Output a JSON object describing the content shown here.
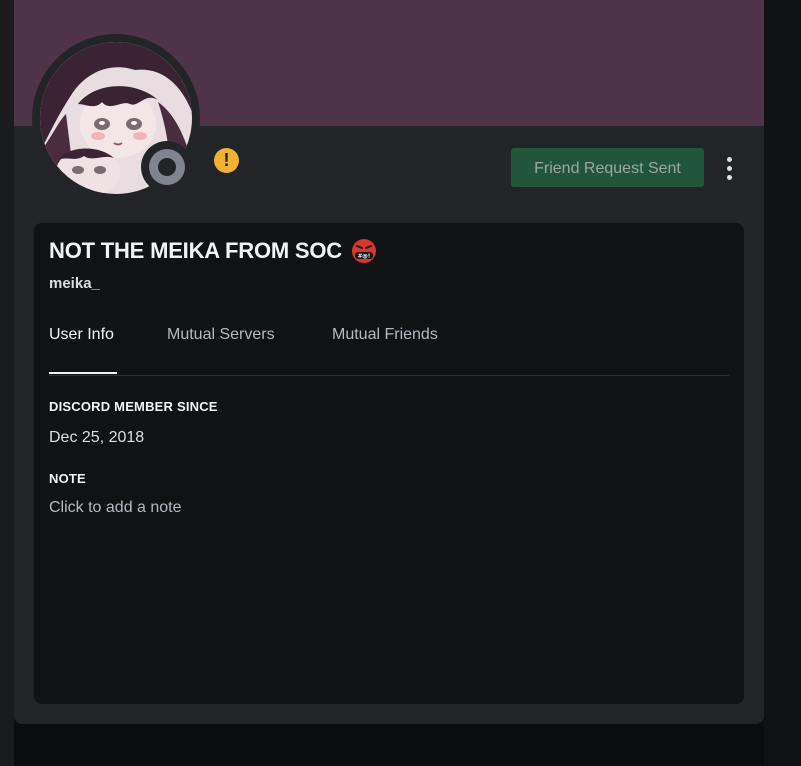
{
  "colors": {
    "banner": "#4f3449",
    "modal_bg": "#232428",
    "card_bg": "#111214",
    "friend_button_bg": "#22563b",
    "status_offline": "#80848e",
    "warning": "#f0b232"
  },
  "header": {
    "status": "offline",
    "warning_icon": "exclamation-icon",
    "warning_glyph": "!",
    "friend_request_label": "Friend Request Sent",
    "more_icon": "more-vertical-icon"
  },
  "profile": {
    "display_name": "NOT THE MEIKA FROM SOC",
    "display_name_emoji": "face-with-symbols-on-mouth-icon",
    "emoji_text": "#@!",
    "username": "meika_"
  },
  "tabs": [
    {
      "label": "User Info",
      "active": true
    },
    {
      "label": "Mutual Servers",
      "active": false
    },
    {
      "label": "Mutual Friends",
      "active": false
    }
  ],
  "user_info": {
    "member_since_title": "DISCORD MEMBER SINCE",
    "member_since_value": "Dec 25, 2018",
    "note_title": "NOTE",
    "note_placeholder": "Click to add a note"
  }
}
